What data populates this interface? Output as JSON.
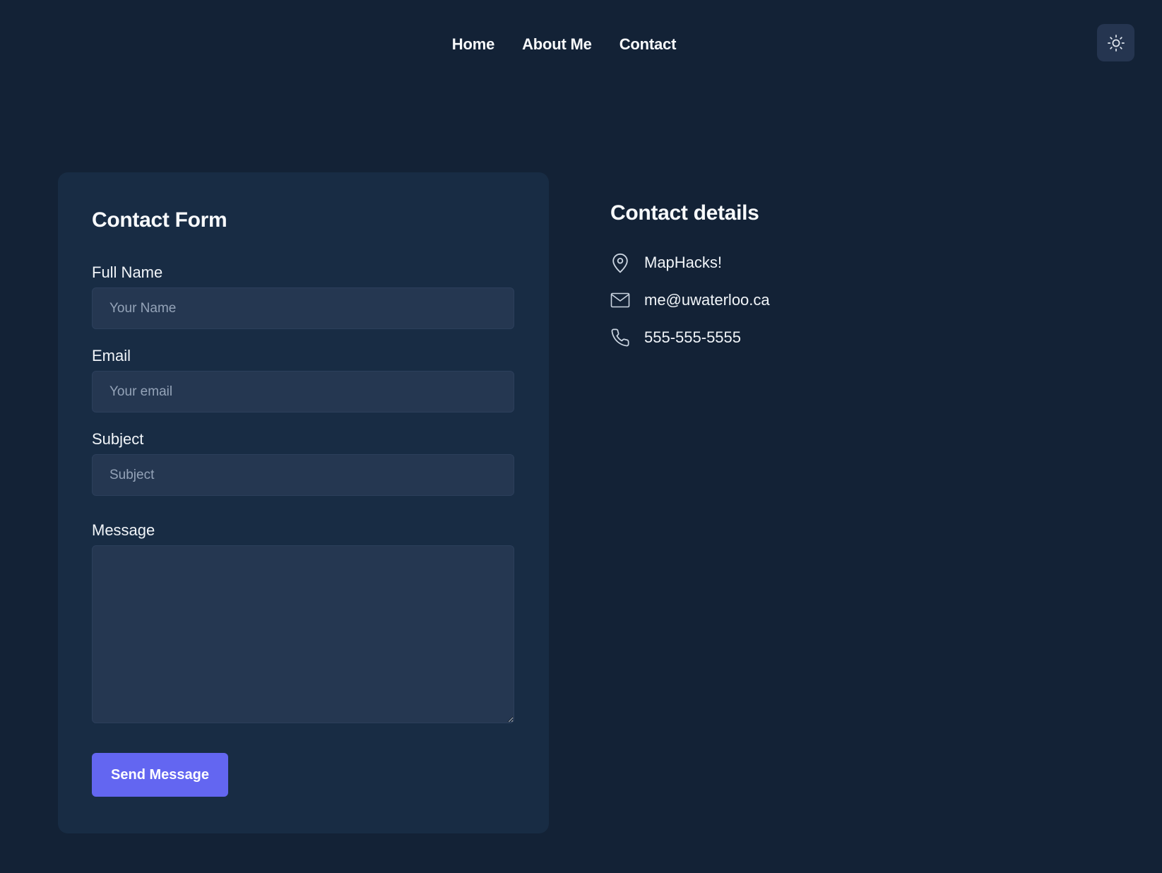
{
  "nav": {
    "items": [
      {
        "label": "Home"
      },
      {
        "label": "About Me"
      },
      {
        "label": "Contact"
      }
    ],
    "theme_toggle_icon": "sun-icon"
  },
  "form": {
    "title": "Contact Form",
    "full_name": {
      "label": "Full Name",
      "value": "",
      "placeholder": "Your Name"
    },
    "email": {
      "label": "Email",
      "value": "",
      "placeholder": "Your email"
    },
    "subject": {
      "label": "Subject",
      "value": "",
      "placeholder": "Subject"
    },
    "message": {
      "label": "Message",
      "value": "",
      "placeholder": ""
    },
    "submit_label": "Send Message"
  },
  "details": {
    "title": "Contact details",
    "items": [
      {
        "icon": "map-pin-icon",
        "text": "MapHacks!"
      },
      {
        "icon": "mail-icon",
        "text": "me@uwaterloo.ca"
      },
      {
        "icon": "phone-icon",
        "text": "555-555-5555"
      }
    ]
  },
  "colors": {
    "background": "#132236",
    "card": "#182c44",
    "input": "#253751",
    "accent": "#6366f1",
    "toggle": "#253550"
  }
}
